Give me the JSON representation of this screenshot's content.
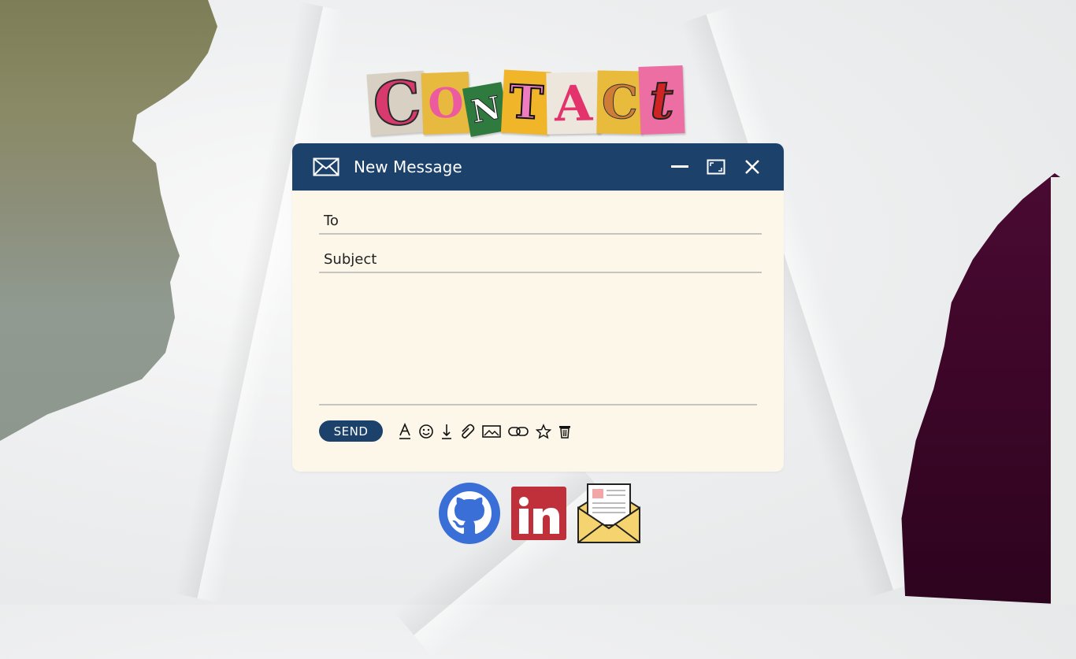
{
  "page": {
    "heading_letters": [
      "C",
      "O",
      "N",
      "T",
      "A",
      "C",
      "t"
    ]
  },
  "compose": {
    "title": "New Message",
    "to_label": "To",
    "subject_label": "Subject",
    "send_label": "SEND",
    "toolbar_icons": [
      "text-format-icon",
      "emoji-icon",
      "download-icon",
      "attachment-icon",
      "image-icon",
      "link-icon",
      "star-icon",
      "trash-icon"
    ]
  },
  "colors": {
    "header_bg": "#1c416b",
    "window_bg": "#fdf7ea",
    "github_blue": "#3a6fd8",
    "linkedin_red": "#c0303a",
    "envelope_yellow": "#f3cf6b"
  },
  "social_icons": [
    "github-icon",
    "linkedin-icon",
    "mail-icon"
  ]
}
